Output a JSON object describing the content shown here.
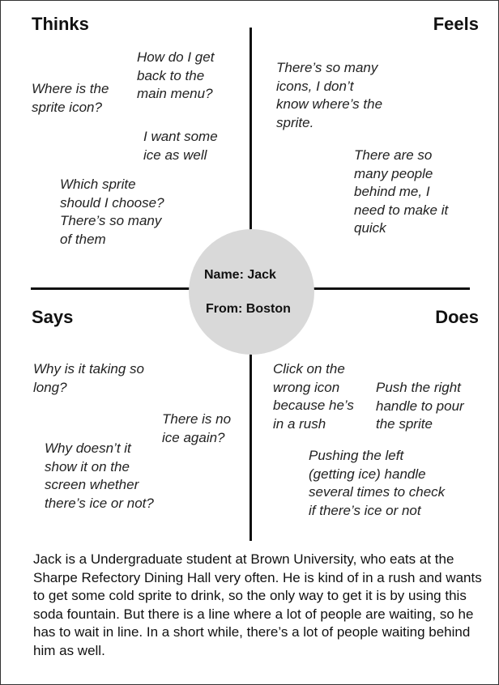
{
  "quadrants": {
    "thinks": {
      "heading": "Thinks",
      "notes": [
        "How do I get\nback to the\nmain menu?",
        "Where is the\nsprite icon?",
        "I want some\nice as well",
        "Which sprite\nshould I choose?\nThere’s so many\nof them"
      ]
    },
    "feels": {
      "heading": "Feels",
      "notes": [
        "There’s so many\nicons, I don’t\nknow where’s the\nsprite.",
        "There are so\nmany people\nbehind me, I\nneed to make it\nquick"
      ]
    },
    "says": {
      "heading": "Says",
      "notes": [
        "Why is it taking so\nlong?",
        "There is no\nice again?",
        "Why doesn’t it\nshow it on the\nscreen whether\nthere’s ice or not?"
      ]
    },
    "does": {
      "heading": "Does",
      "notes": [
        "Click on the\nwrong icon\nbecause he’s\nin a rush",
        "Push the right\nhandle to pour\nthe sprite",
        "Pushing the left\n(getting ice) handle\nseveral times to check\nif there’s ice or not"
      ]
    }
  },
  "persona": {
    "name": "Name: Jack",
    "from": "From: Boston",
    "circle_color": "#d9d9d9"
  },
  "description": "Jack is a Undergraduate student at Brown University, who eats at the Sharpe Refectory Dining Hall very often. He is kind of in a rush and wants to get some cold sprite to drink, so the only way to get it is by using this soda fountain. But there is a line where a lot of people are waiting, so he has to wait in line. In a short while, there’s a lot of people waiting behind him as well."
}
